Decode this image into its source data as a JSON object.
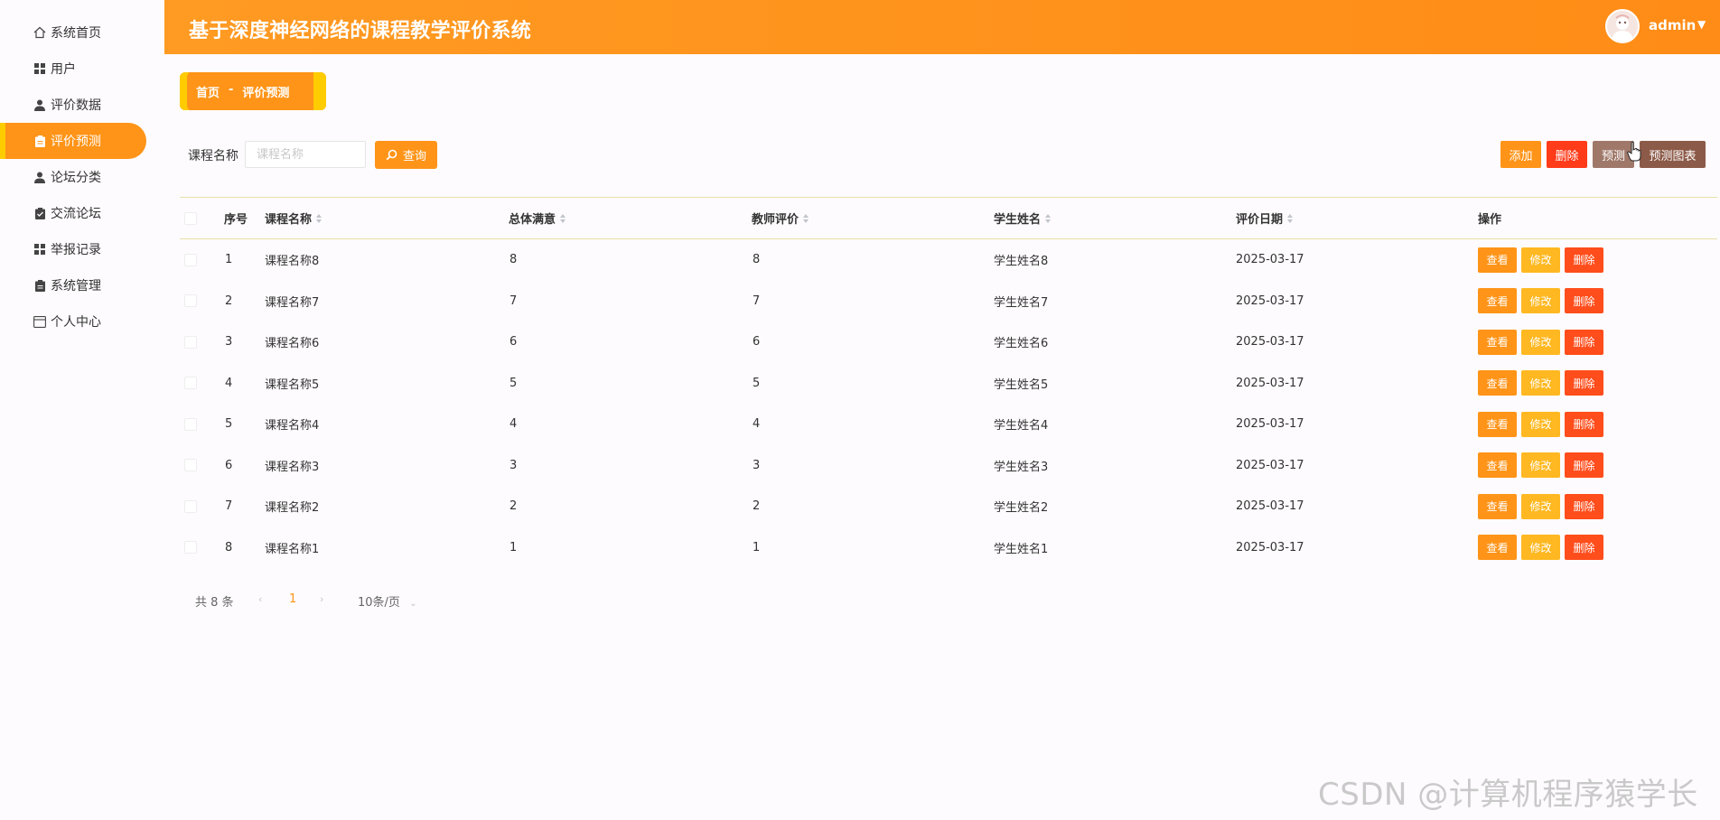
{
  "sidebar": {
    "items": [
      {
        "label": "系统首页",
        "icon": "home-icon"
      },
      {
        "label": "用户",
        "icon": "grid-icon"
      },
      {
        "label": "评价数据",
        "icon": "person-icon"
      },
      {
        "label": "评价预测",
        "icon": "clipboard-icon",
        "active": true
      },
      {
        "label": "论坛分类",
        "icon": "person-icon"
      },
      {
        "label": "交流论坛",
        "icon": "clipboard-check-icon"
      },
      {
        "label": "举报记录",
        "icon": "grid-icon"
      },
      {
        "label": "系统管理",
        "icon": "clipboard-icon"
      },
      {
        "label": "个人中心",
        "icon": "window-icon"
      }
    ]
  },
  "header": {
    "title": "基于深度神经网络的课程教学评价系统",
    "user": "admin"
  },
  "breadcrumb": {
    "home": "首页",
    "separator": "-",
    "current": "评价预测"
  },
  "search": {
    "label": "课程名称",
    "placeholder": "课程名称",
    "button": "查询"
  },
  "toolbar": {
    "add": "添加",
    "delete": "删除",
    "predict": "预测",
    "predict_chart": "预测图表"
  },
  "table": {
    "headers": [
      "序号",
      "课程名称",
      "总体满意",
      "教师评价",
      "学生姓名",
      "评价日期",
      "操作"
    ],
    "rows": [
      {
        "index": "1",
        "course": "课程名称8",
        "satisfaction": "8",
        "teacher": "8",
        "student": "学生姓名8",
        "date": "2025-03-17"
      },
      {
        "index": "2",
        "course": "课程名称7",
        "satisfaction": "7",
        "teacher": "7",
        "student": "学生姓名7",
        "date": "2025-03-17"
      },
      {
        "index": "3",
        "course": "课程名称6",
        "satisfaction": "6",
        "teacher": "6",
        "student": "学生姓名6",
        "date": "2025-03-17"
      },
      {
        "index": "4",
        "course": "课程名称5",
        "satisfaction": "5",
        "teacher": "5",
        "student": "学生姓名5",
        "date": "2025-03-17"
      },
      {
        "index": "5",
        "course": "课程名称4",
        "satisfaction": "4",
        "teacher": "4",
        "student": "学生姓名4",
        "date": "2025-03-17"
      },
      {
        "index": "6",
        "course": "课程名称3",
        "satisfaction": "3",
        "teacher": "3",
        "student": "学生姓名3",
        "date": "2025-03-17"
      },
      {
        "index": "7",
        "course": "课程名称2",
        "satisfaction": "2",
        "teacher": "2",
        "student": "学生姓名2",
        "date": "2025-03-17"
      },
      {
        "index": "8",
        "course": "课程名称1",
        "satisfaction": "1",
        "teacher": "1",
        "student": "学生姓名1",
        "date": "2025-03-17"
      }
    ],
    "actions": {
      "view": "查看",
      "edit": "修改",
      "delete": "删除"
    }
  },
  "pagination": {
    "total": "共 8 条",
    "current_page": "1",
    "page_size": "10条/页"
  },
  "watermark": "CSDN @计算机程序猿学长",
  "colors": {
    "accent": "#ff9418",
    "accent_yellow": "#ffcc00",
    "danger": "#ff4d1b",
    "predict": "#a0786a",
    "predict_chart": "#8c5a48"
  }
}
